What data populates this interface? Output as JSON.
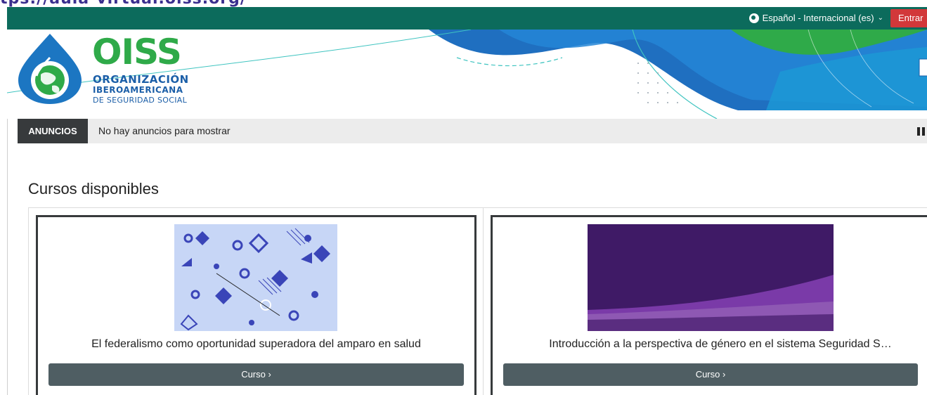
{
  "url_fragment": "tps://aula-virtual.oiss.org/",
  "topbar": {
    "language_label": "Español - Internacional (es)",
    "login_label": "Entrar"
  },
  "logo": {
    "acronym": "OISS",
    "line1": "ORGANIZACIÓN",
    "line2": "IBEROAMERICANA",
    "line3": "DE SEGURIDAD SOCIAL"
  },
  "announcements": {
    "label": "ANUNCIOS",
    "text": "No hay anuncios para mostrar"
  },
  "courses_section": {
    "title": "Cursos disponibles",
    "courses": [
      {
        "name": "El federalismo como oportunidad superadora del amparo en salud",
        "button_label": "Curso ›"
      },
      {
        "name": "Introducción a la perspectiva de género en el sistema Seguridad S…",
        "button_label": "Curso ›"
      }
    ]
  },
  "colors": {
    "topbar": "#0c6b5c",
    "login": "#d2383a",
    "brand_green": "#2faa49",
    "brand_blue": "#1c5fa8",
    "announce_label_bg": "#373a3c",
    "course_button": "#4f5e63"
  }
}
